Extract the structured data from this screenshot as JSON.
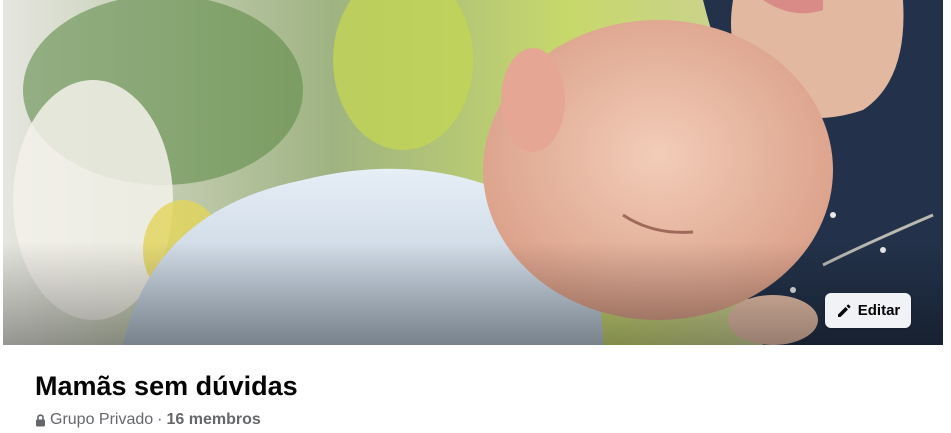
{
  "group": {
    "name": "Mamãs sem dúvidas",
    "privacy": "Grupo Privado",
    "separator": "·",
    "members": "16 membros",
    "privacy_icon": "lock-icon"
  },
  "cover": {
    "edit_label": "Editar",
    "edit_icon": "pencil-icon",
    "photo": "cover-photo"
  },
  "colors": {
    "text_primary": "#050505",
    "text_secondary": "#65676b",
    "button_bg": "#f0f2f5"
  }
}
